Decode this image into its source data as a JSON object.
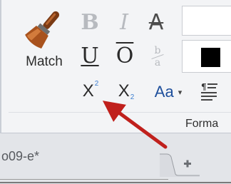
{
  "ribbon": {
    "match": {
      "label": "Match",
      "icon": "paintbrush-icon"
    },
    "buttons": {
      "bold": "B",
      "italic": "I",
      "strikethrough": "A",
      "underline": "U",
      "overline": "O",
      "fraction_num": "b",
      "fraction_den": "a",
      "superscript_base": "X",
      "superscript_mini": "2",
      "subscript_base": "X",
      "subscript_mini": "2",
      "change_case": "Aa",
      "change_case_caret": "▾"
    },
    "group_label": "Forma",
    "colors": {
      "swatch": "#000000",
      "accent": "#1e4f9c",
      "arrow": "#c0201c"
    }
  },
  "tabs": {
    "active_label": "o09-e*",
    "add_tab_icon": "plus-icon"
  }
}
